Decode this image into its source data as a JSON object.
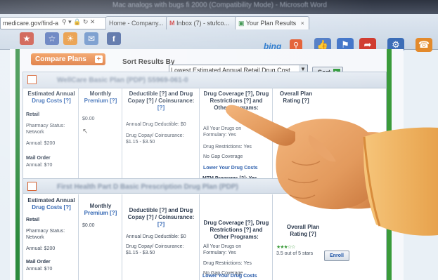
{
  "window": {
    "title": "Mac analogs with bugs fi 2000 (Compatibility Mode) - Microsoft Word"
  },
  "browser": {
    "address": "medicare.gov/find-a",
    "tabs": [
      {
        "label": "Home - Company..."
      },
      {
        "label": "Inbox (7) - stufco..."
      },
      {
        "label": "Your Plan Results",
        "close": "×"
      }
    ],
    "search_brand": "bing"
  },
  "page": {
    "compare_button": "Compare Plans",
    "sort_label": "Sort Results By",
    "sort_value": "Lowest Estimated Annual Retail Drug Cost",
    "sort_button": "Sort"
  },
  "plans": [
    {
      "name": "WellCare Basic Plan (PDP) S5969-061-0",
      "headers": {
        "cost": [
          "Estimated Annual",
          "Drug Costs [?]"
        ],
        "premium": [
          "Monthly",
          "Premium [?]"
        ],
        "deductible": [
          "Deductible [?] and Drug",
          "Copay [?] / Coinsurance:",
          "[?]"
        ],
        "coverage": [
          "Drug Coverage [?], Drug",
          "Restrictions [?] and",
          "Other Programs:"
        ],
        "rating": [
          "Overall Plan",
          "Rating [?]"
        ]
      },
      "retail_label": "Retail",
      "pharmacy_status": [
        "Pharmacy Status:",
        "Network"
      ],
      "annual_retail": "Annual: $200",
      "mail_label": "Mail Order",
      "annual_mail": "Annual: $70",
      "premium_value": "$0.00",
      "deductible_value": "Annual Drug Deductible: $0",
      "copay_label": "Drug Copay/ Coinsurance:",
      "copay_value": "$1.15 - $3.50",
      "coverage_lines": [
        "All Your Drugs on",
        "Formulary: Yes",
        "Drug Restrictions: Yes",
        "No Gap Coverage"
      ],
      "lower_costs": "Lower Your Drug Costs",
      "mtm": "MTM Programs [?]: Yes"
    },
    {
      "name": "First Health Part D Basic Prescription Drug Plan (PDP)",
      "headers": {
        "cost": [
          "Estimated Annual",
          "Drug Costs [?]"
        ],
        "premium": [
          "Monthly",
          "Premium [?]"
        ],
        "deductible": [
          "Deductible [?] and Drug",
          "Copay [?] / Coinsurance:",
          "[?]"
        ],
        "coverage": [
          "Drug Coverage [?], Drug",
          "Restrictions [?] and",
          "Other Programs:"
        ],
        "rating": [
          "Overall Plan",
          "Rating [?]"
        ]
      },
      "retail_label": "Retail",
      "pharmacy_status": [
        "Pharmacy Status:",
        "Network"
      ],
      "annual_retail": "Annual: $200",
      "mail_label": "Mail Order",
      "annual_mail": "Annual: $70",
      "premium_value": "$0.00",
      "deductible_value": "Annual Drug Deductible: $0",
      "copay_label": "Drug Copay/ Coinsurance:",
      "copay_value": "$1.15 - $3.50",
      "coverage_lines": [
        "All Your Drugs on",
        "Formulary: Yes",
        "Drug Restrictions: Yes",
        "No Gap Coverage"
      ],
      "lower_costs": "Lower Your Drug Costs",
      "rating_text": "3.5 out of 5 stars",
      "enroll": "Enroll"
    }
  ],
  "colors": {
    "accent_orange": "#d9641f",
    "side_green": "#2d8a3c",
    "link_blue": "#2156a8",
    "skin": "#e9a46a",
    "sleeve": "#f2b566"
  },
  "icons": [
    "favorite-icon",
    "facebook-icon",
    "search-icon",
    "thumbs-up-icon",
    "new-badge-icon",
    "close-icon"
  ]
}
